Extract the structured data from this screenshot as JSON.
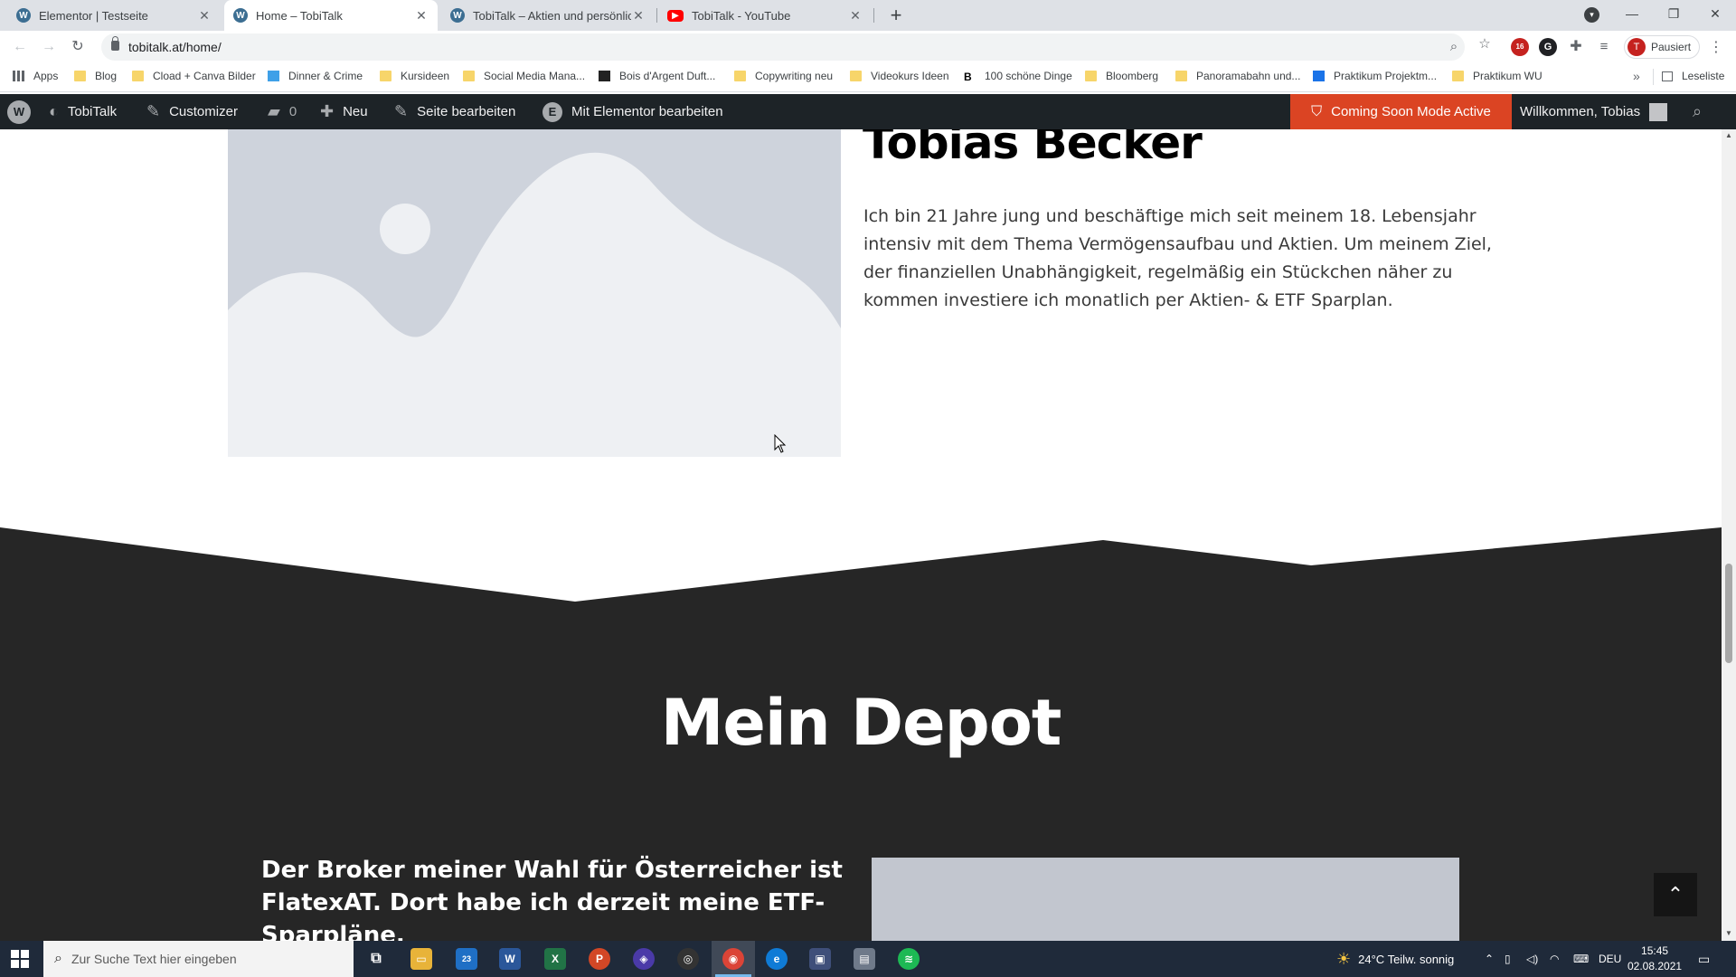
{
  "browser": {
    "tabs": [
      {
        "title": "Elementor | Testseite",
        "favicon": "wordpress-icon",
        "active": false
      },
      {
        "title": "Home – TobiTalk",
        "favicon": "wordpress-icon",
        "active": true
      },
      {
        "title": "TobiTalk – Aktien und persönliche",
        "favicon": "wordpress-icon",
        "active": false
      },
      {
        "title": "TobiTalk - YouTube",
        "favicon": "youtube-icon",
        "active": false
      }
    ],
    "url": "tobitalk.at/home/",
    "profile_label": "Pausiert",
    "profile_initial": "T",
    "extension_badge": "16",
    "bookmarks": [
      "Apps",
      "Blog",
      "Cload + Canva Bilder",
      "Dinner & Crime",
      "Kursideen",
      "Social Media Mana...",
      "Bois d'Argent Duft...",
      "Copywriting neu",
      "Videokurs Ideen",
      "100 schöne Dinge",
      "Bloomberg",
      "Panoramabahn und...",
      "Praktikum Projektm...",
      "Praktikum WU"
    ],
    "reading_list": "Leseliste"
  },
  "wp_admin_bar": {
    "site_name": "TobiTalk",
    "customizer": "Customizer",
    "comments_count": "0",
    "new_label": "Neu",
    "edit_page": "Seite bearbeiten",
    "elementor_edit": "Mit Elementor bearbeiten",
    "coming_soon": "Coming Soon Mode Active",
    "welcome": "Willkommen, Tobias"
  },
  "page": {
    "name": "Tobias Becker",
    "bio": "Ich bin 21 Jahre jung und beschäftige mich seit meinem 18. Lebensjahr intensiv mit dem Thema Vermögensaufbau und Aktien. Um meinem Ziel, der finanziellen Unabhängigkeit, regelmäßig ein Stückchen näher zu kommen investiere ich monatlich per Aktien- & ETF Sparplan.",
    "depot_title": "Mein Depot",
    "broker_text": "Der Broker meiner Wahl für Österreicher ist FlatexAT. Dort habe ich derzeit meine ETF-Sparpläne."
  },
  "taskbar": {
    "search_placeholder": "Zur Suche Text hier eingeben",
    "mail_badge": "23",
    "weather": "24°C  Teilw. sonnig",
    "language": "DEU",
    "time": "15:45",
    "date": "02.08.2021"
  },
  "colors": {
    "wp_bar": "#1d2327",
    "coming_soon": "#db4423",
    "dark_section": "#262626",
    "placeholder": "#ced3dc"
  }
}
